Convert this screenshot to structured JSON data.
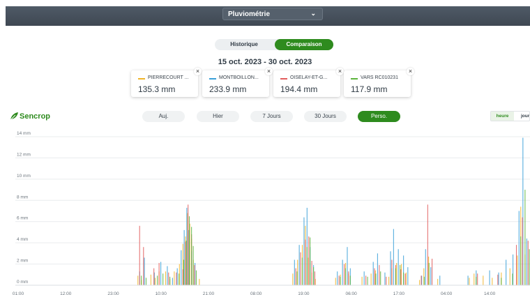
{
  "header": {
    "metric_label": "Pluviométrie",
    "metric_icon": "chevron-down-icon"
  },
  "mode_toggle": {
    "historique": "Historique",
    "comparaison": "Comparaison",
    "active": "Comparaison"
  },
  "date_range": "15 oct. 2023 - 30 oct. 2023",
  "stations": [
    {
      "name": "PIERRECOURT ...",
      "value": "135.3 mm",
      "color": "#f0b429"
    },
    {
      "name": "MONTBOILLON...",
      "value": "233.9 mm",
      "color": "#3aa0d8"
    },
    {
      "name": "OISELAY-ET-G...",
      "value": "194.4 mm",
      "color": "#e25c5c"
    },
    {
      "name": "VARS RC010231",
      "value": "117.9 mm",
      "color": "#5cb43c"
    }
  ],
  "close_glyph": "×",
  "logo": {
    "text": "Sencrop",
    "icon": "sencrop-leaf-icon",
    "color": "#2e8b1e"
  },
  "periods": [
    "Auj.",
    "Hier",
    "7 Jours",
    "30 Jours",
    "Perso."
  ],
  "active_period": "Perso.",
  "granularity": {
    "options": [
      "heure",
      "jour"
    ],
    "active": "heure"
  },
  "chart_data": {
    "type": "bar",
    "title": "",
    "xlabel": "",
    "ylabel": "",
    "ylim": [
      0,
      14
    ],
    "y_ticks": [
      "0 mm",
      "2 mm",
      "4 mm",
      "6 mm",
      "8 mm",
      "10 mm",
      "12 mm",
      "14 mm"
    ],
    "x_ticks": [
      "01:00",
      "12:00",
      "23:00",
      "10:00",
      "21:00",
      "08:00",
      "19:00",
      "06:00",
      "17:00",
      "04:00",
      "14:00"
    ],
    "x_tick_hours": [
      0,
      11,
      22,
      33,
      44,
      55,
      66,
      77,
      88,
      99,
      109
    ],
    "x_range_hours": [
      0,
      118
    ],
    "grid": true,
    "legend": "none",
    "series": [
      {
        "name": "PIERRECOURT ...",
        "color": "#f0b429",
        "points": [
          [
            27.6,
            0.9
          ],
          [
            28.4,
            0.5
          ],
          [
            30.6,
            1.0
          ],
          [
            31.6,
            0.7
          ],
          [
            32.5,
            1.3
          ],
          [
            34.0,
            1.3
          ],
          [
            35.0,
            0.6
          ],
          [
            36.0,
            1.3
          ],
          [
            37.2,
            2.0
          ],
          [
            38.0,
            3.9
          ],
          [
            38.6,
            4.6
          ],
          [
            39.1,
            6.8
          ],
          [
            39.6,
            5.8
          ],
          [
            40.0,
            4.4
          ],
          [
            40.4,
            2.4
          ],
          [
            41.8,
            0.6
          ],
          [
            63.4,
            1.1
          ],
          [
            64.5,
            2.4
          ],
          [
            65.6,
            3.8
          ],
          [
            66.3,
            5.6
          ],
          [
            67.0,
            2.6
          ],
          [
            67.8,
            1.2
          ],
          [
            68.6,
            0.6
          ],
          [
            73.3,
            0.7
          ],
          [
            74.4,
            1.0
          ],
          [
            75.6,
            2.1
          ],
          [
            76.3,
            1.1
          ],
          [
            79.4,
            0.8
          ],
          [
            81.5,
            1.1
          ],
          [
            82.5,
            1.4
          ],
          [
            85.6,
            0.8
          ],
          [
            86.3,
            1.6
          ],
          [
            87.4,
            2.1
          ],
          [
            88.5,
            2.0
          ],
          [
            89.6,
            1.2
          ],
          [
            92.7,
            0.5
          ],
          [
            93.7,
            1.6
          ],
          [
            94.8,
            2.7
          ],
          [
            96.9,
            0.6
          ],
          [
            104.2,
            0.7
          ],
          [
            105.3,
            1.1
          ],
          [
            107.4,
            0.9
          ],
          [
            109.5,
            0.7
          ],
          [
            111.6,
            1.2
          ],
          [
            113.6,
            1.6
          ],
          [
            115.3,
            2.8
          ],
          [
            116.1,
            7.4
          ],
          [
            117.1,
            2.9
          ]
        ]
      },
      {
        "name": "MONTBOILLON...",
        "color": "#3aa0d8",
        "points": [
          [
            27.9,
            1.3
          ],
          [
            29.0,
            2.6
          ],
          [
            31.3,
            1.2
          ],
          [
            32.8,
            2.2
          ],
          [
            34.3,
            1.8
          ],
          [
            35.5,
            0.7
          ],
          [
            36.6,
            1.6
          ],
          [
            37.5,
            3.3
          ],
          [
            38.2,
            5.2
          ],
          [
            38.8,
            7.3
          ],
          [
            39.3,
            5.2
          ],
          [
            39.9,
            3.2
          ],
          [
            40.7,
            2.1
          ],
          [
            63.7,
            2.4
          ],
          [
            64.8,
            3.8
          ],
          [
            65.9,
            6.4
          ],
          [
            66.6,
            7.3
          ],
          [
            67.3,
            3.6
          ],
          [
            68.1,
            1.9
          ],
          [
            73.6,
            1.3
          ],
          [
            74.8,
            2.4
          ],
          [
            75.9,
            3.6
          ],
          [
            76.6,
            1.6
          ],
          [
            79.8,
            1.3
          ],
          [
            81.9,
            2.2
          ],
          [
            82.9,
            3.0
          ],
          [
            84.6,
            1.2
          ],
          [
            85.9,
            3.2
          ],
          [
            86.6,
            5.3
          ],
          [
            87.7,
            3.4
          ],
          [
            88.9,
            2.8
          ],
          [
            89.9,
            1.7
          ],
          [
            93.1,
            0.9
          ],
          [
            94.0,
            3.4
          ],
          [
            95.2,
            1.7
          ],
          [
            97.3,
            0.9
          ],
          [
            103.8,
            0.9
          ],
          [
            105.7,
            1.4
          ],
          [
            108.8,
            1.4
          ],
          [
            110.9,
            1.2
          ],
          [
            112.6,
            2.4
          ],
          [
            114.2,
            2.9
          ],
          [
            115.6,
            7.0
          ],
          [
            116.5,
            13.9
          ],
          [
            117.4,
            4.4
          ]
        ]
      },
      {
        "name": "OISELAY-ET-G...",
        "color": "#e25c5c",
        "points": [
          [
            27.8,
            5.6
          ],
          [
            28.7,
            3.6
          ],
          [
            31.1,
            1.6
          ],
          [
            32.3,
            2.1
          ],
          [
            34.5,
            1.2
          ],
          [
            36.3,
            1.2
          ],
          [
            37.8,
            1.5
          ],
          [
            38.4,
            4.1
          ],
          [
            39.0,
            7.6
          ],
          [
            39.8,
            4.8
          ],
          [
            40.5,
            1.9
          ],
          [
            63.9,
            1.6
          ],
          [
            65.0,
            3.1
          ],
          [
            66.1,
            4.3
          ],
          [
            66.9,
            4.6
          ],
          [
            67.6,
            2.3
          ],
          [
            68.3,
            1.3
          ],
          [
            73.9,
            0.9
          ],
          [
            75.1,
            2.0
          ],
          [
            76.1,
            1.3
          ],
          [
            80.1,
            0.9
          ],
          [
            82.1,
            1.6
          ],
          [
            83.2,
            1.9
          ],
          [
            84.8,
            0.8
          ],
          [
            86.1,
            2.4
          ],
          [
            87.0,
            1.9
          ],
          [
            88.2,
            1.5
          ],
          [
            89.2,
            1.1
          ],
          [
            92.9,
            0.9
          ],
          [
            94.4,
            7.6
          ],
          [
            95.4,
            2.5
          ],
          [
            105.9,
            1.1
          ],
          [
            110.6,
            1.0
          ],
          [
            114.9,
            3.8
          ],
          [
            116.3,
            6.4
          ],
          [
            117.6,
            4.2
          ]
        ]
      },
      {
        "name": "VARS RC010231",
        "color": "#5cb43c",
        "points": [
          [
            28.1,
            0.9
          ],
          [
            29.2,
            0.7
          ],
          [
            31.8,
            0.9
          ],
          [
            33.1,
            1.1
          ],
          [
            34.7,
            0.8
          ],
          [
            36.8,
            1.1
          ],
          [
            37.9,
            2.4
          ],
          [
            38.5,
            4.2
          ],
          [
            39.2,
            6.5
          ],
          [
            39.7,
            5.5
          ],
          [
            40.1,
            3.7
          ],
          [
            40.8,
            1.4
          ],
          [
            64.1,
            1.3
          ],
          [
            65.3,
            2.6
          ],
          [
            66.4,
            3.6
          ],
          [
            67.1,
            4.5
          ],
          [
            67.9,
            1.7
          ],
          [
            74.1,
            0.8
          ],
          [
            75.3,
            1.6
          ],
          [
            76.4,
            0.9
          ],
          [
            80.4,
            0.8
          ],
          [
            82.3,
            1.1
          ],
          [
            83.4,
            1.3
          ],
          [
            86.9,
            1.6
          ],
          [
            87.9,
            1.9
          ],
          [
            88.7,
            1.2
          ],
          [
            93.5,
            0.8
          ],
          [
            94.6,
            2.1
          ],
          [
            105.5,
            0.8
          ],
          [
            111.3,
            0.7
          ],
          [
            113.9,
            1.1
          ],
          [
            115.8,
            4.6
          ],
          [
            116.8,
            9.0
          ],
          [
            117.8,
            3.4
          ]
        ]
      }
    ]
  }
}
